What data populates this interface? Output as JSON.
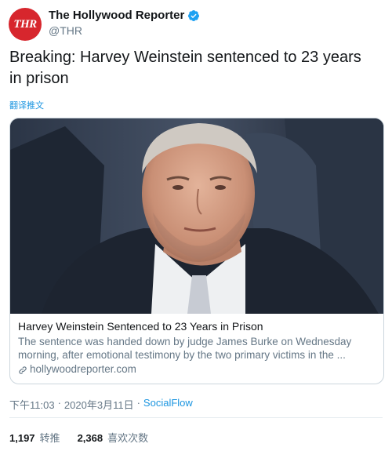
{
  "account": {
    "avatar_text": "THR",
    "display_name": "The Hollywood Reporter",
    "handle": "@THR"
  },
  "tweet": {
    "text_line1": "Breaking: Harvey Weinstein sentenced to 23 years",
    "text_line2": "in prison",
    "translate_label": "翻译推文"
  },
  "card": {
    "image_subject": "portrait photo of Harvey Weinstein",
    "title": "Harvey Weinstein Sentenced to 23 Years in Prison",
    "description_line1": "The sentence was handed down by judge James Burke on Wednesday",
    "description_line2": "morning, after emotional testimony by the two primary victims in the ...",
    "domain": "hollywoodreporter.com"
  },
  "meta": {
    "time": "下午11:03",
    "separator1": "·",
    "date": "2020年3月11日",
    "separator2": "·",
    "source": "SocialFlow"
  },
  "stats": {
    "retweets_count": "1,197",
    "retweets_label": "转推",
    "likes_count": "2,368",
    "likes_label": "喜欢次数"
  },
  "colors": {
    "avatar_red": "#d7262d",
    "verified_blue": "#1da1f2",
    "link_blue": "#1b95e0",
    "secondary_text": "#657786"
  },
  "icons": [
    "verified-badge-icon",
    "link-icon"
  ]
}
